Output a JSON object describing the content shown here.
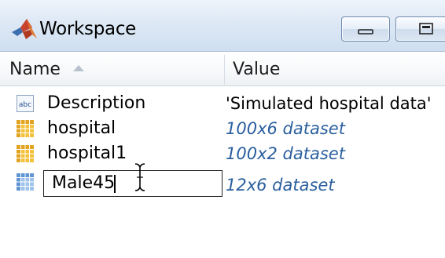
{
  "window": {
    "title": "Workspace",
    "icon": "matlab-logo-icon",
    "buttons": [
      "minimize",
      "maximize"
    ]
  },
  "table": {
    "columns": [
      {
        "label": "Name",
        "sort": "ascending"
      },
      {
        "label": "Value"
      }
    ],
    "rows": [
      {
        "icon": "abc-char-icon",
        "name": "Description",
        "value": "'Simulated hospital data'",
        "value_kind": "string"
      },
      {
        "icon": "table-grid-icon",
        "name": "hospital",
        "value": "100x6 dataset",
        "value_kind": "dataset"
      },
      {
        "icon": "table-grid-icon",
        "name": "hospital1",
        "value": "100x2 dataset",
        "value_kind": "dataset"
      },
      {
        "icon": "table-grid-icon",
        "name": "Male45",
        "value": "12x6 dataset",
        "value_kind": "dataset",
        "editing": true
      }
    ]
  },
  "colors": {
    "dataset_value": "#2a5f9e",
    "titlebar": "#dde8f5"
  }
}
